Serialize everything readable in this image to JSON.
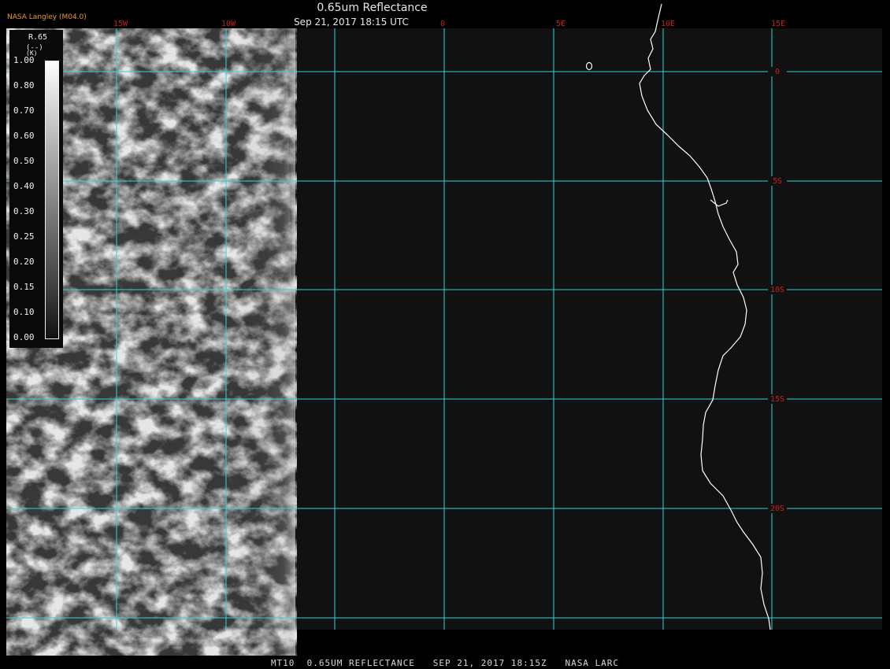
{
  "header": {
    "title": "0.65um Reflectance",
    "datetime": "Sep 21, 2017 18:15 UTC",
    "provider": "NASA Langley (M04.0)"
  },
  "footer": {
    "text": "MT10  0.65UM REFLECTANCE   SEP 21, 2017 18:15Z   NASA LARC"
  },
  "legend": {
    "title": "R.65",
    "units": "(--)",
    "units_sub": "(K)",
    "ticks": [
      "1.00",
      "0.80",
      "0.70",
      "0.60",
      "0.50",
      "0.40",
      "0.30",
      "0.25",
      "0.20",
      "0.15",
      "0.10",
      "0.00"
    ]
  },
  "map": {
    "longitude_labels": [
      "15W",
      "10W",
      "0",
      "5E",
      "10E",
      "15E"
    ],
    "latitude_labels": [
      "0",
      "5S",
      "10S",
      "15S",
      "20S"
    ],
    "grid_color": "#2fd3d8",
    "label_color": "#c82020",
    "coastline_color": "#ffffff",
    "background_color": "#111111"
  }
}
